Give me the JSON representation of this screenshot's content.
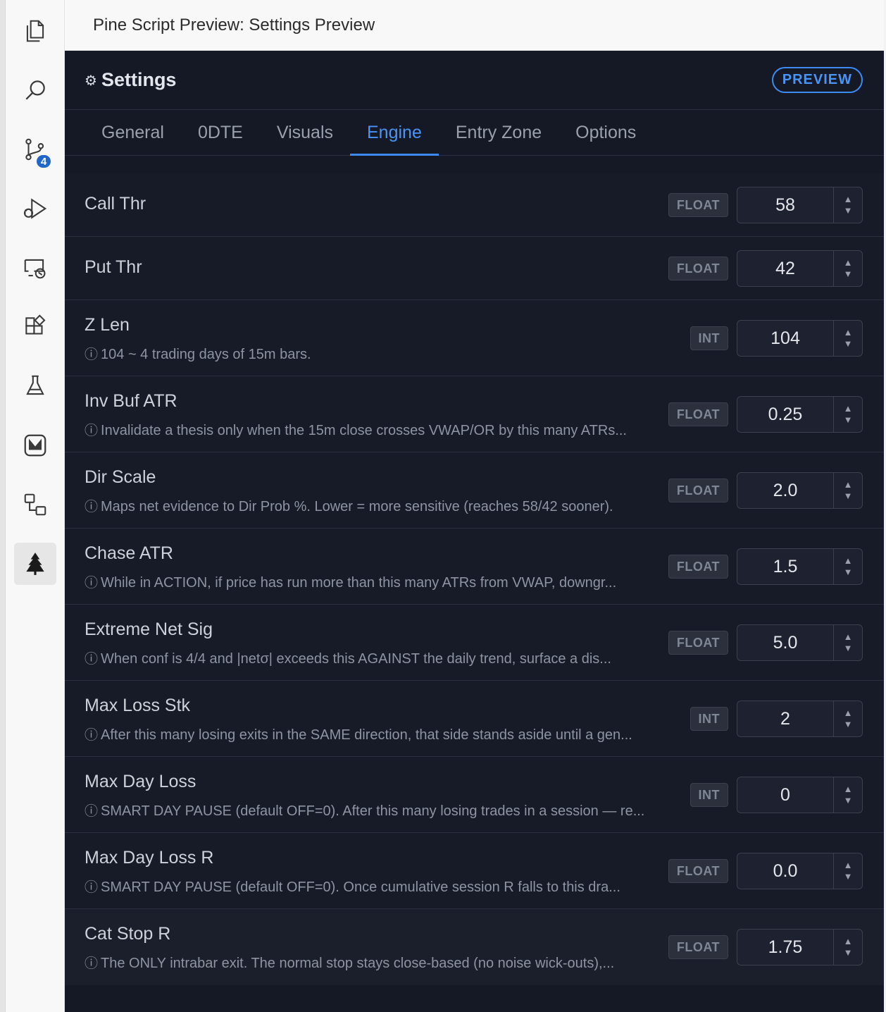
{
  "window": {
    "tab_title": "Pine Script Preview: Settings Preview"
  },
  "activity_bar": {
    "source_control_badge": "4"
  },
  "panel": {
    "title": "Settings",
    "badge": "PREVIEW",
    "tabs": [
      "General",
      "0DTE",
      "Visuals",
      "Engine",
      "Entry Zone",
      "Options"
    ],
    "active_tab": "Engine"
  },
  "settings": [
    {
      "label": "Call Thr",
      "type": "FLOAT",
      "value": "58",
      "desc": ""
    },
    {
      "label": "Put Thr",
      "type": "FLOAT",
      "value": "42",
      "desc": ""
    },
    {
      "label": "Z Len",
      "type": "INT",
      "value": "104",
      "desc": "104 ~ 4 trading days of 15m bars."
    },
    {
      "label": "Inv Buf ATR",
      "type": "FLOAT",
      "value": "0.25",
      "desc": "Invalidate a thesis only when the 15m close crosses VWAP/OR by this many ATRs..."
    },
    {
      "label": "Dir Scale",
      "type": "FLOAT",
      "value": "2.0",
      "desc": "Maps net evidence to Dir Prob %. Lower = more sensitive (reaches 58/42 sooner)."
    },
    {
      "label": "Chase ATR",
      "type": "FLOAT",
      "value": "1.5",
      "desc": "While in ACTION, if price has run more than this many ATRs from VWAP, downgr..."
    },
    {
      "label": "Extreme Net Sig",
      "type": "FLOAT",
      "value": "5.0",
      "desc": "When conf is 4/4 and |netσ| exceeds this AGAINST the daily trend, surface a dis..."
    },
    {
      "label": "Max Loss Stk",
      "type": "INT",
      "value": "2",
      "desc": "After this many losing exits in the SAME direction, that side stands aside until a gen..."
    },
    {
      "label": "Max Day Loss",
      "type": "INT",
      "value": "0",
      "desc": "SMART DAY PAUSE (default OFF=0). After this many losing trades in a session — re..."
    },
    {
      "label": "Max Day Loss R",
      "type": "FLOAT",
      "value": "0.0",
      "desc": "SMART DAY PAUSE (default OFF=0). Once cumulative session R falls to this dra..."
    },
    {
      "label": "Cat Stop R",
      "type": "FLOAT",
      "value": "1.75",
      "desc": "The ONLY intrabar exit. The normal stop stays close-based (no noise wick-outs),..."
    }
  ],
  "icons": {
    "explorer": "files-icon",
    "search": "search-icon",
    "source_control": "source-control-icon",
    "run_debug": "run-debug-icon",
    "remote": "remote-explorer-icon",
    "extensions": "extensions-icon",
    "testing": "flask-icon",
    "gitkraken": "gitkraken-icon",
    "connections": "connections-icon",
    "pine": "pine-tree-icon"
  }
}
